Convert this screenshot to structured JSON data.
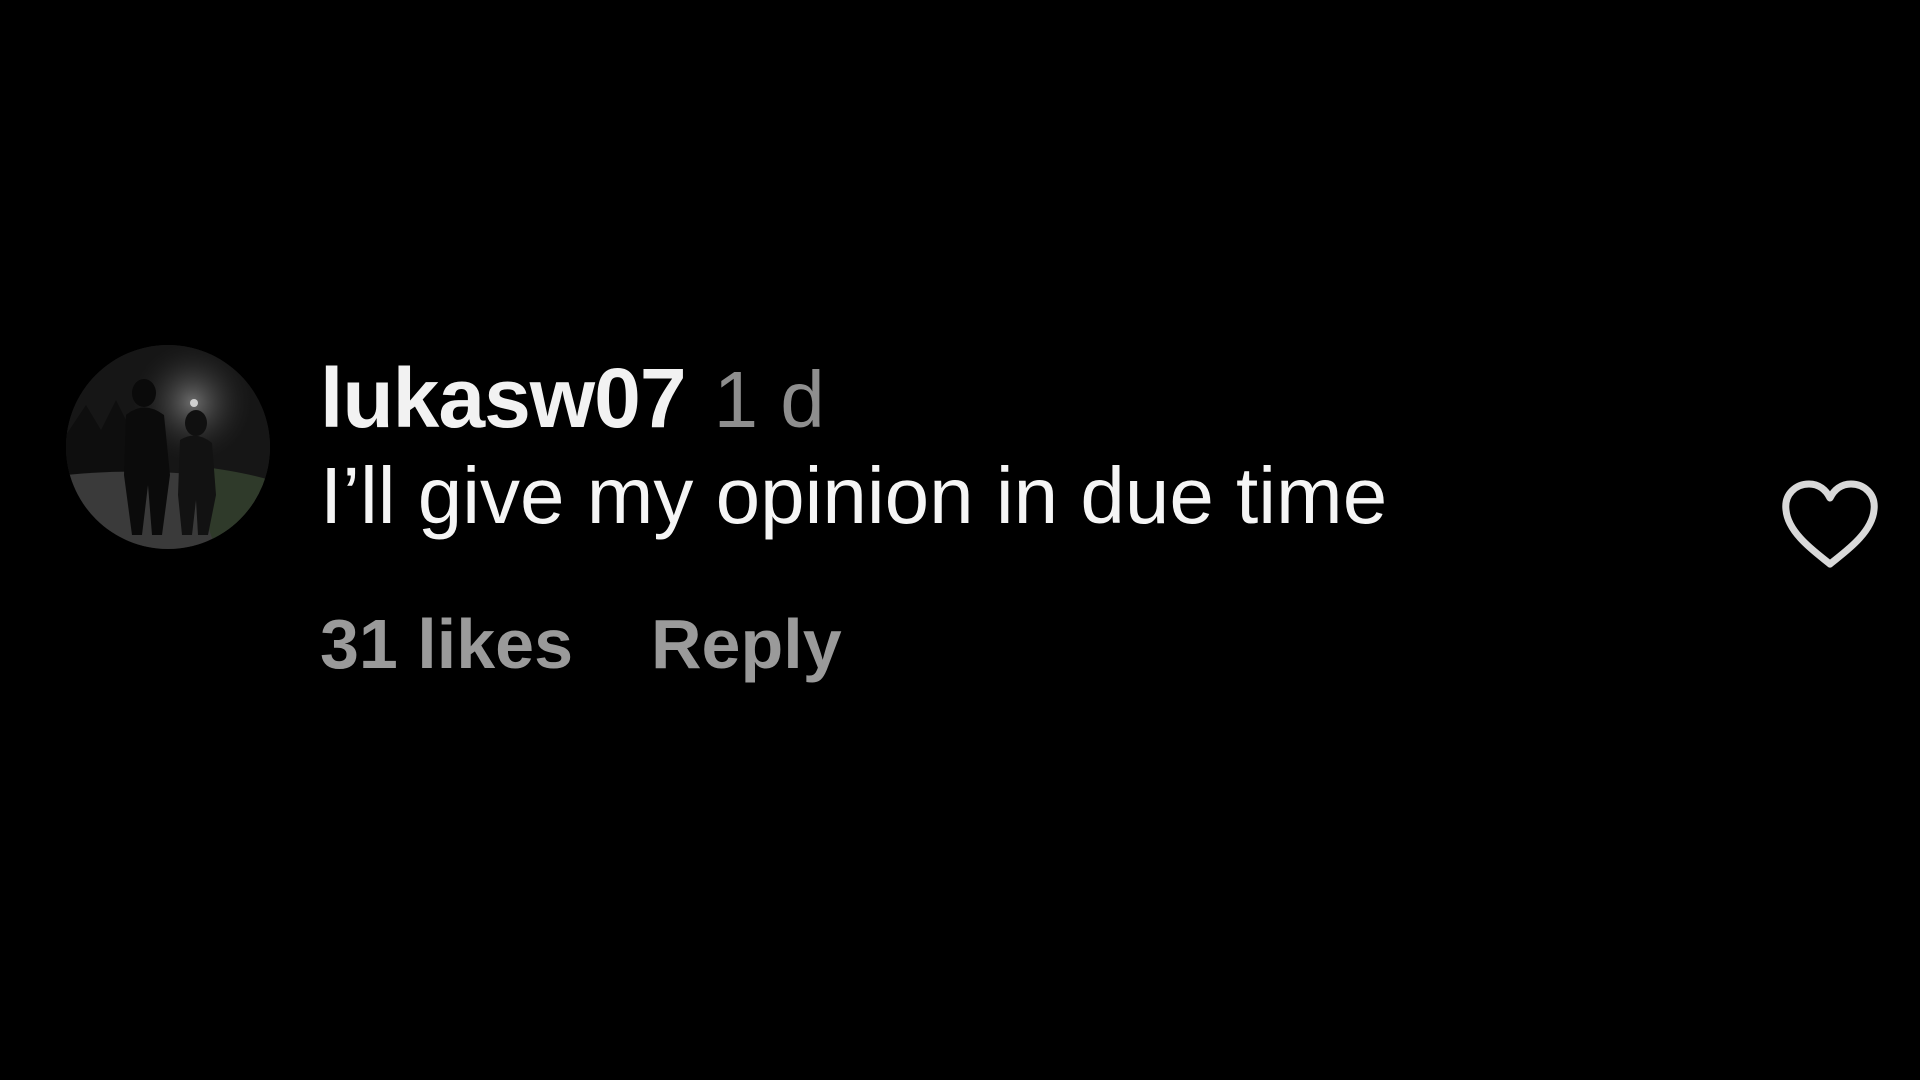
{
  "comment": {
    "username": "lukasw07",
    "timestamp": "1 d",
    "text": "I’ll give my opinion in due time",
    "likes_label": "31 likes",
    "reply_label": "Reply",
    "avatar_icon": "avatar-photo",
    "like_icon": "heart-outline-icon"
  },
  "colors": {
    "background": "#000000",
    "username": "#f2f2f2",
    "secondary": "#8e8e8e",
    "heart_stroke": "#d9d9d9"
  }
}
